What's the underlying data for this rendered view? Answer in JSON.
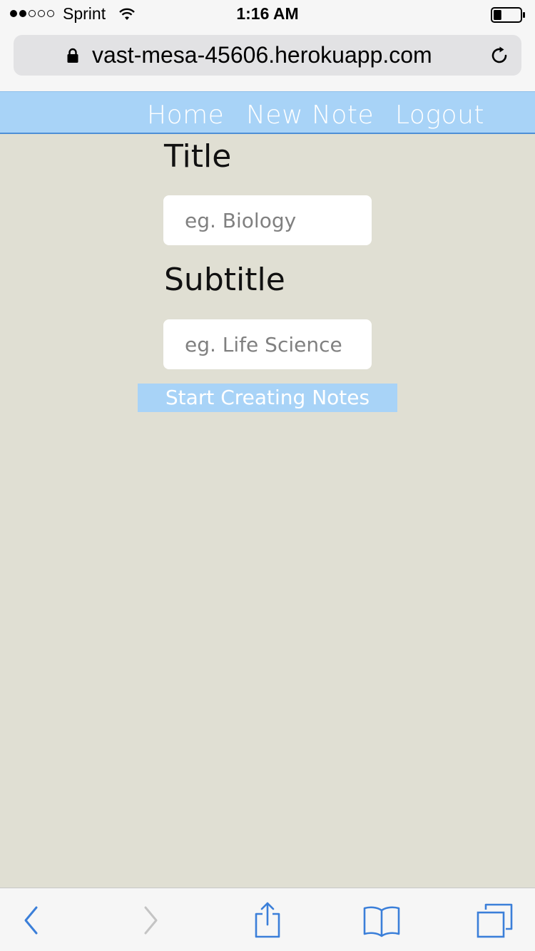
{
  "status_bar": {
    "signal_bars_filled": 2,
    "signal_bars_total": 5,
    "carrier": "Sprint",
    "time": "1:16 AM",
    "battery_level": 0.3
  },
  "browser": {
    "url": "vast-mesa-45606.herokuapp.com",
    "lock_icon": "lock-icon",
    "reload_icon": "reload-icon"
  },
  "nav": {
    "home": "Home",
    "new_note": "New Note",
    "logout": "Logout"
  },
  "form": {
    "title_label": "Title",
    "title_placeholder": "eg. Biology",
    "subtitle_label": "Subtitle",
    "subtitle_placeholder": "eg. Life Science",
    "submit_label": "Start Creating Notes"
  },
  "toolbar": {
    "icons": [
      "back-icon",
      "forward-icon",
      "share-icon",
      "bookmarks-icon",
      "tabs-icon"
    ]
  },
  "colors": {
    "page_background": "#e0dfd3",
    "nav_background": "#a8d3f7",
    "nav_border": "#4e8fd6",
    "toolbar_accent": "#3b7fd9",
    "toolbar_disabled": "#c4c4c4"
  }
}
